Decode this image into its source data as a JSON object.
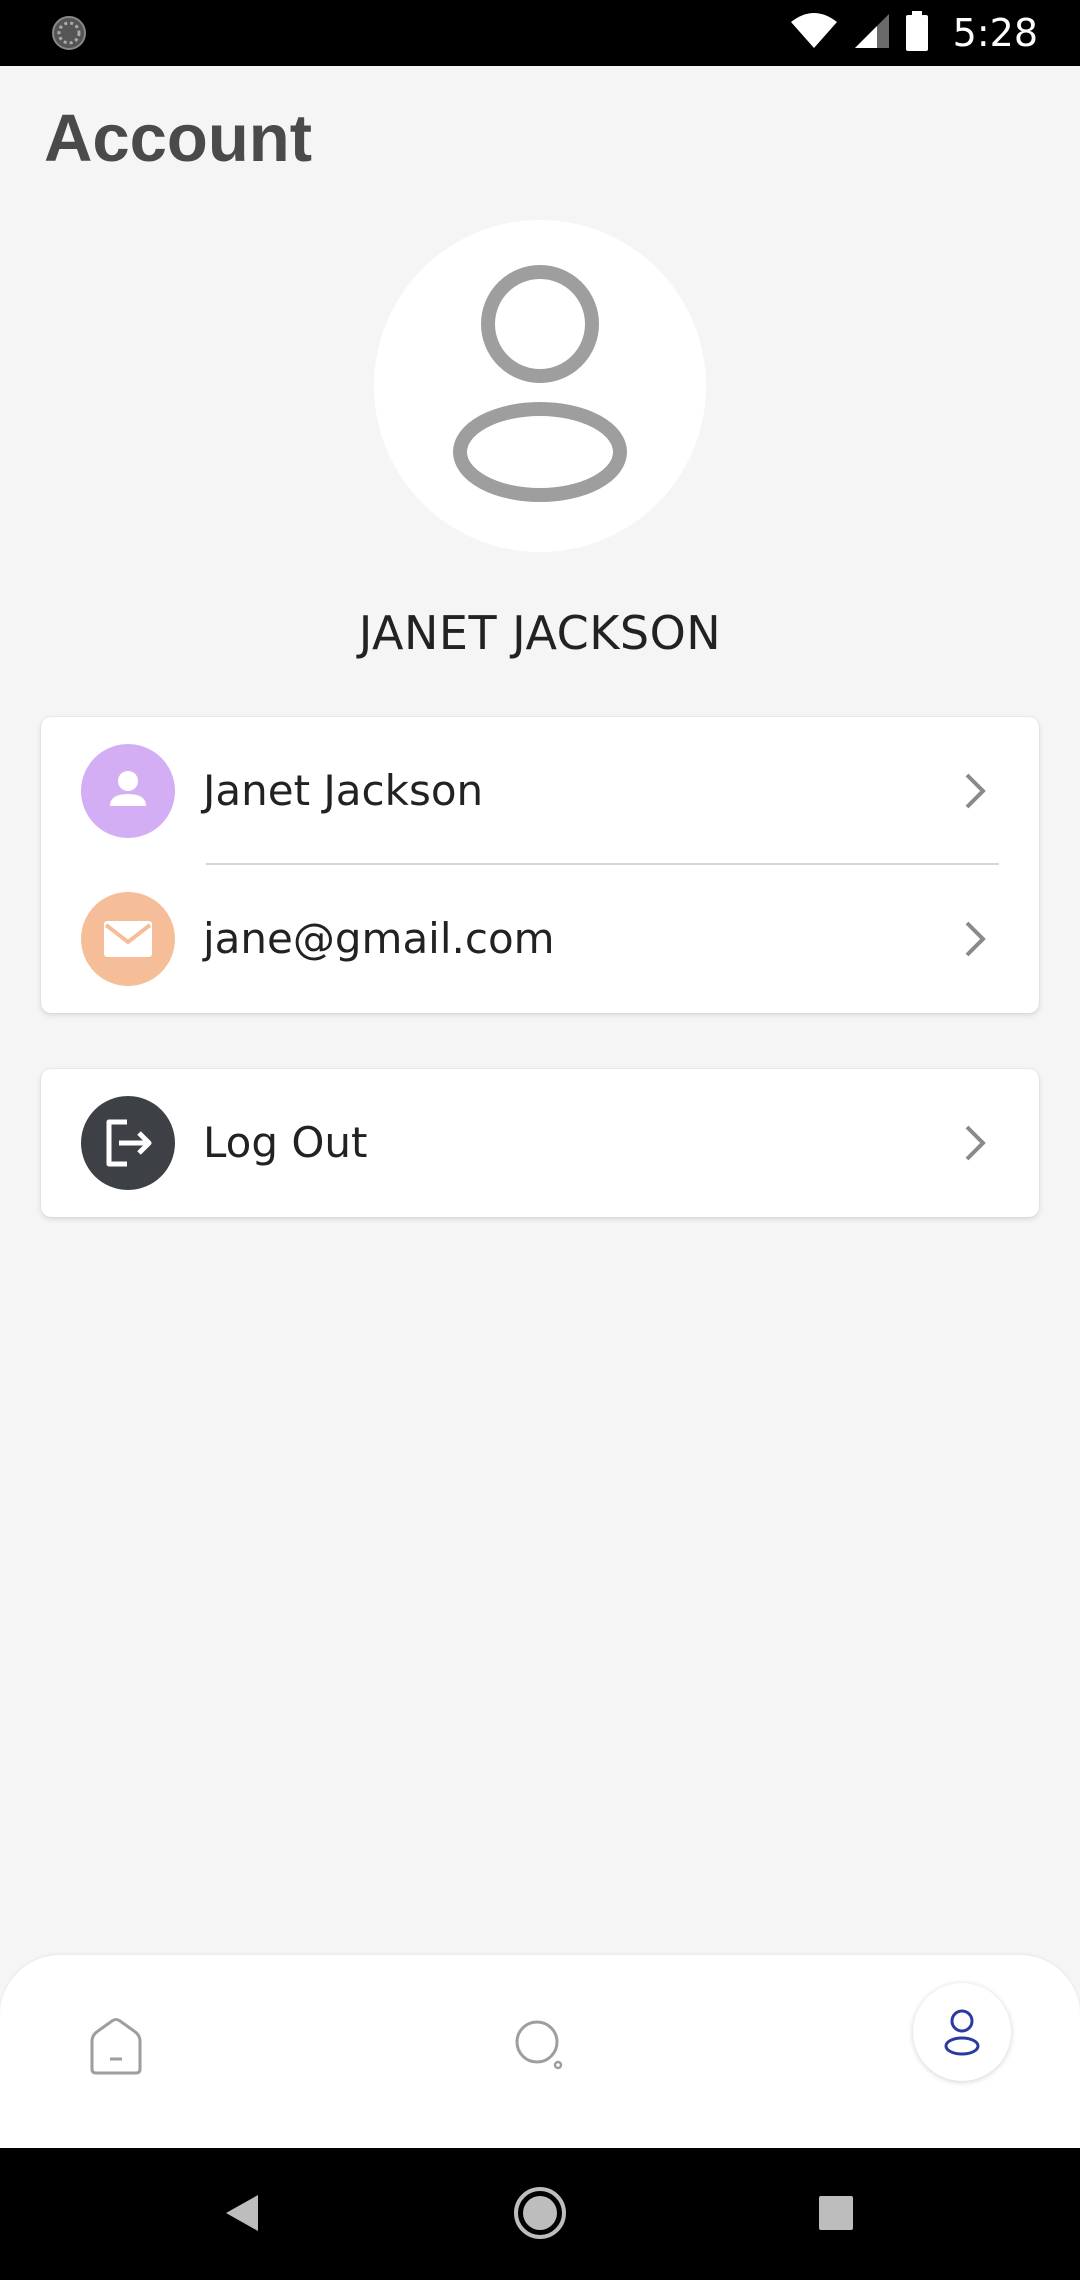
{
  "status_bar": {
    "time": "5:28",
    "icons": [
      "spinner-icon",
      "wifi-icon",
      "cell-signal-icon",
      "battery-icon"
    ]
  },
  "page": {
    "title": "Account"
  },
  "profile": {
    "avatar_icon": "user-icon",
    "name": "JANET JACKSON"
  },
  "info_card": {
    "rows": [
      {
        "icon": "person-icon",
        "label": "Janet Jackson",
        "icon_bg": "#d4aef5"
      },
      {
        "icon": "mail-icon",
        "label": "jane@gmail.com",
        "icon_bg": "#f5be98"
      }
    ]
  },
  "logout_card": {
    "icon": "logout-icon",
    "label": "Log Out",
    "icon_bg": "#3d4045"
  },
  "bottom_nav": {
    "items": [
      {
        "name": "home",
        "icon": "home-icon",
        "active": false
      },
      {
        "name": "search",
        "icon": "search-icon",
        "active": false
      },
      {
        "name": "account",
        "icon": "user-icon",
        "active": true
      }
    ],
    "active_color": "#2a3aa0",
    "inactive_color": "#9e9e9e"
  },
  "system_nav": {
    "icons": [
      "back-icon",
      "home-circle-icon",
      "recents-icon"
    ]
  },
  "colors": {
    "background": "#f5f5f5",
    "text_primary": "#222222",
    "title": "#4a4a4a",
    "chevron": "#8a8a8a"
  }
}
